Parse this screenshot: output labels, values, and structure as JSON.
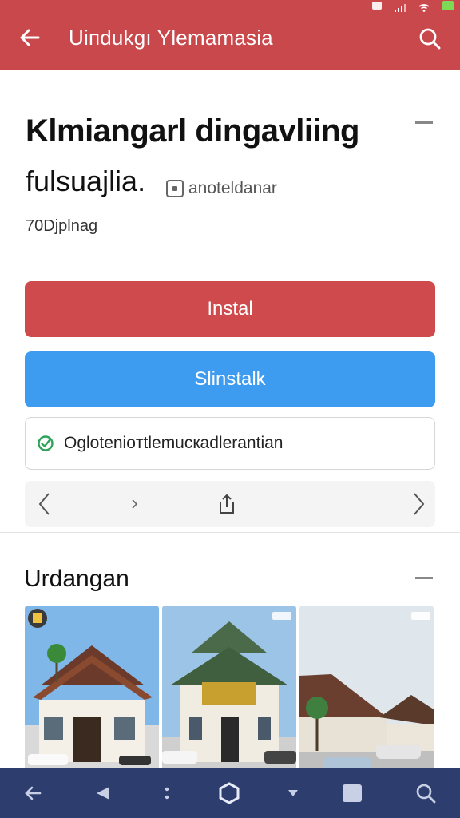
{
  "app_bar": {
    "title": "Uiпdukgı Ylemamasia",
    "back_icon": "arrow-left-icon",
    "search_icon": "search-icon",
    "color": "#c9484c"
  },
  "status_bar": {
    "icons": [
      "notification-icon",
      "signal-icon",
      "wifi-icon",
      "battery-icon"
    ]
  },
  "header": {
    "headline": "Klmiangarl dingavliing",
    "subline": "fulsuajlia.",
    "tag_label": "anoteldanar",
    "meta": "70Djplnag"
  },
  "actions": {
    "install_label": "Instal",
    "uninstall_label": "Slinstalk",
    "install_color": "#cf4a4c",
    "uninstall_color": "#3d9bf0"
  },
  "notice": {
    "text": "Oglotenioтtlemucкadlerantian",
    "icon": "shield-check-icon",
    "icon_color": "#2fa35a"
  },
  "pager": {
    "icons": [
      "chevron-left-icon",
      "chevron-small-icon",
      "share-icon",
      "chevron-right-icon"
    ]
  },
  "gallery": {
    "title": "Urdangan",
    "items": [
      {
        "name": "gallery-photo-1",
        "badge": "gallery-badge-icon"
      },
      {
        "name": "gallery-photo-2"
      },
      {
        "name": "gallery-photo-3"
      }
    ]
  },
  "bottom_nav": {
    "color": "#2d3e6e",
    "icons": [
      "back-arrow-icon",
      "triangle-back-icon",
      "dots-icon",
      "home-icon",
      "down-caret-icon",
      "square-icon",
      "search-icon"
    ]
  }
}
